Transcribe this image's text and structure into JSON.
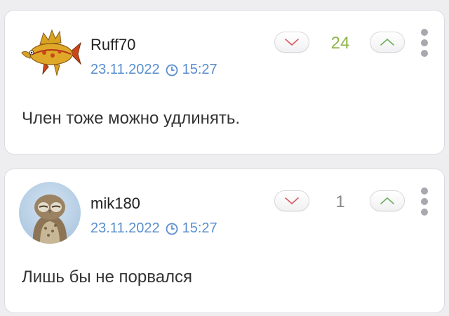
{
  "colors": {
    "background": "#eeeef1",
    "card": "#ffffff",
    "timestamp": "#5a8fcf",
    "score_positive": "#8fb54a",
    "score_neutral": "#888888",
    "downvote_chevron": "#d65a62",
    "upvote_chevron": "#6cae5a"
  },
  "comments": [
    {
      "username": "Ruff70",
      "avatar_icon": "golden-fish-avatar",
      "date": "23.11.2022",
      "time": "15:27",
      "score": "24",
      "text": "Член тоже можно удлинять."
    },
    {
      "username": "mik180",
      "avatar_icon": "owl-avatar",
      "date": "23.11.2022",
      "time": "15:27",
      "score": "1",
      "text": "Лишь бы не порвался"
    }
  ]
}
